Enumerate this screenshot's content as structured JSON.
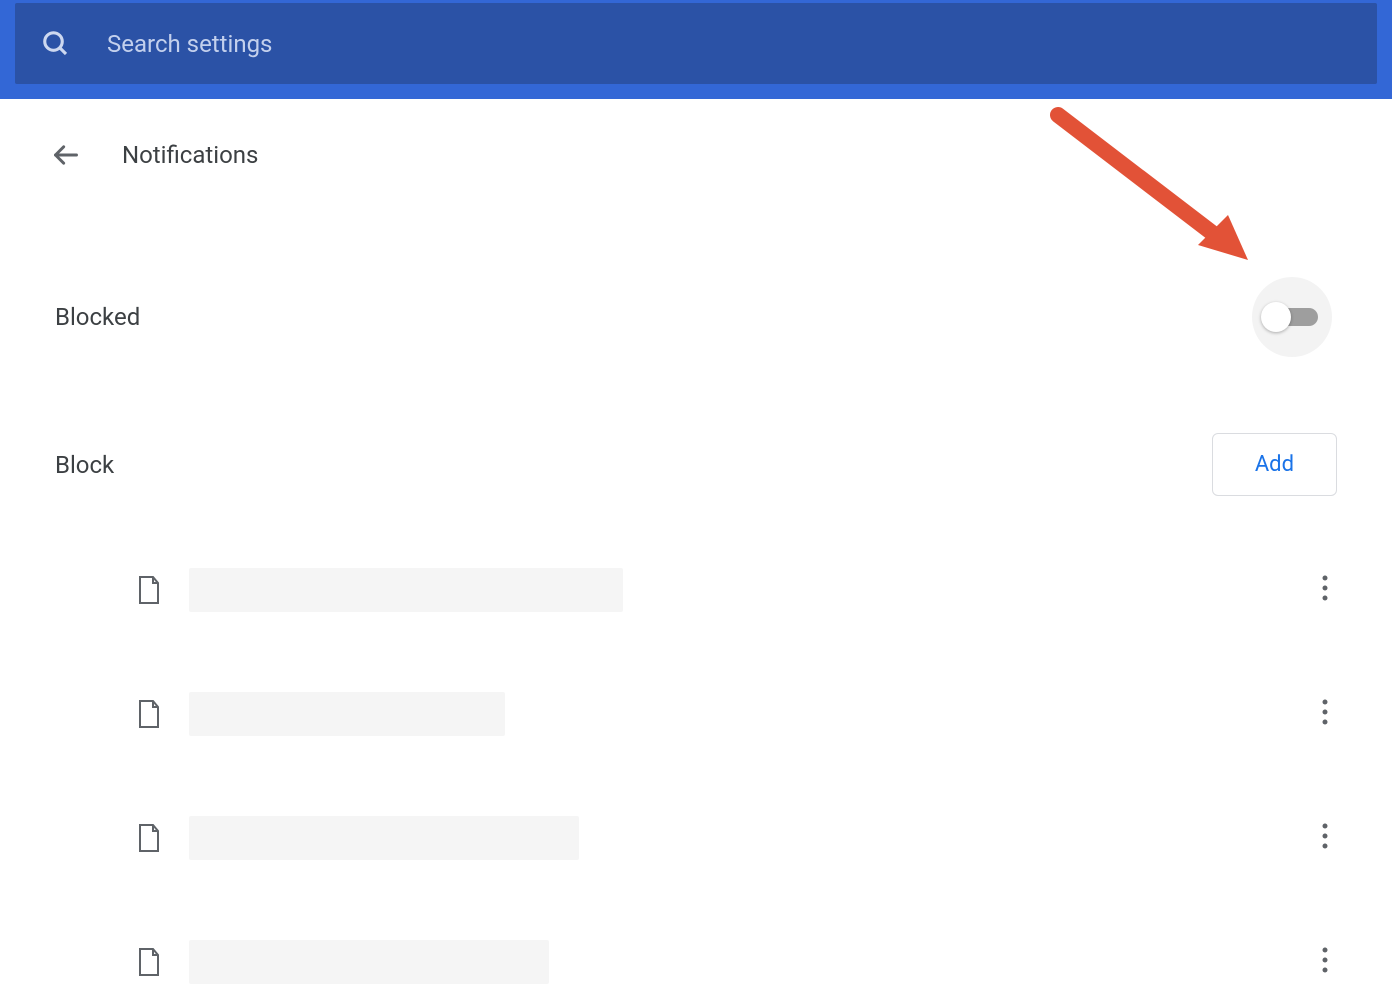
{
  "search": {
    "placeholder": "Search settings"
  },
  "page": {
    "title": "Notifications"
  },
  "sections": {
    "blocked_label": "Blocked",
    "block_label": "Block",
    "add_button_label": "Add"
  },
  "site_items": [
    {
      "placeholder_width": 434
    },
    {
      "placeholder_width": 316
    },
    {
      "placeholder_width": 390
    },
    {
      "placeholder_width": 360
    }
  ],
  "toggle": {
    "state": "off"
  }
}
